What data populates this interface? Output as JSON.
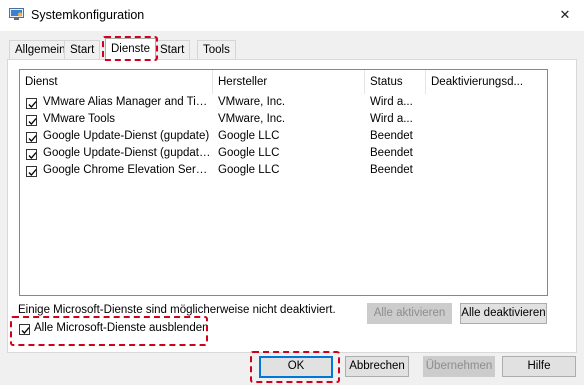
{
  "window": {
    "title": "Systemkonfiguration",
    "close_glyph": "✕"
  },
  "tabs": [
    {
      "label": "Allgemein"
    },
    {
      "label": "Start"
    },
    {
      "label": "Dienste"
    },
    {
      "label": "Start"
    },
    {
      "label": "Tools"
    }
  ],
  "services": {
    "columns": [
      "Dienst",
      "Hersteller",
      "Status",
      "Deaktivierungsd..."
    ],
    "rows": [
      {
        "name": "VMware Alias Manager and Ticke...",
        "vendor": "VMware, Inc.",
        "status": "Wird a...",
        "checked": true
      },
      {
        "name": "VMware Tools",
        "vendor": "VMware, Inc.",
        "status": "Wird a...",
        "checked": true
      },
      {
        "name": "Google Update-Dienst (gupdate)",
        "vendor": "Google LLC",
        "status": "Beendet",
        "checked": true
      },
      {
        "name": "Google Update-Dienst (gupdatem)",
        "vendor": "Google LLC",
        "status": "Beendet",
        "checked": true
      },
      {
        "name": "Google Chrome Elevation Servic...",
        "vendor": "Google LLC",
        "status": "Beendet",
        "checked": true
      }
    ]
  },
  "info_text": "Einige Microsoft-Dienste sind möglicherweise nicht deaktiviert.",
  "buttons": {
    "enable_all": "Alle aktivieren",
    "disable_all": "Alle deaktivieren",
    "ok": "OK",
    "cancel": "Abbrechen",
    "apply": "Übernehmen",
    "help": "Hilfe"
  },
  "hide_microsoft": {
    "label": "Alle Microsoft-Dienste ausblenden",
    "checked": true
  },
  "colors": {
    "highlight": "#d0021b",
    "focus": "#0078d7"
  }
}
